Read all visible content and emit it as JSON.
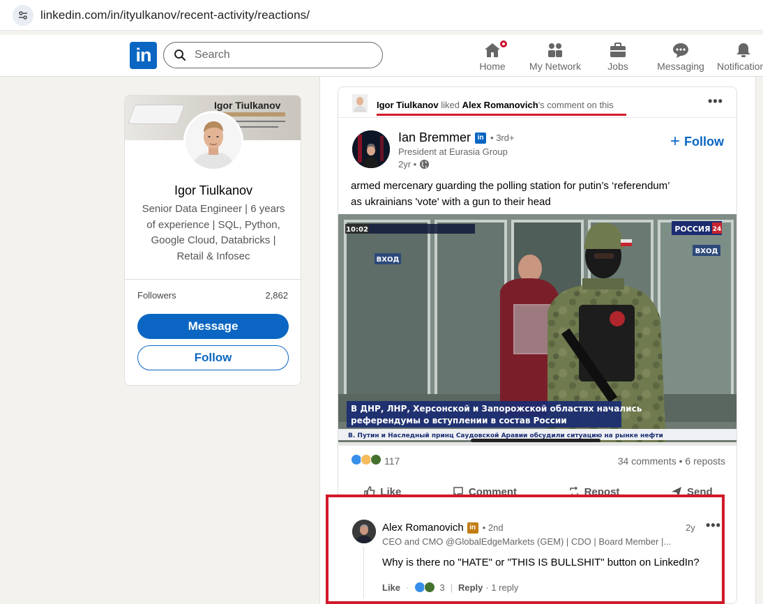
{
  "browser": {
    "url": "linkedin.com/in/ityulkanov/recent-activity/reactions/"
  },
  "nav": {
    "search_placeholder": "Search",
    "items": [
      {
        "label": "Home",
        "icon": "home-icon"
      },
      {
        "label": "My Network",
        "icon": "network-icon"
      },
      {
        "label": "Jobs",
        "icon": "briefcase-icon"
      },
      {
        "label": "Messaging",
        "icon": "chat-icon"
      },
      {
        "label": "Notifications",
        "icon": "bell-icon"
      }
    ]
  },
  "profile": {
    "banner_name": "Igor Tiulkanov",
    "name": "Igor Tiulkanov",
    "headline": "Senior Data Engineer | 6 years of experience | SQL, Python, Google Cloud, Databricks | Retail & Infosec",
    "followers_label": "Followers",
    "followers_count": "2,862",
    "message_label": "Message",
    "follow_label": "Follow"
  },
  "activity": {
    "actor": "Igor Tiulkanov",
    "verb": "liked",
    "target": "Alex Romanovich",
    "suffix": "'s comment on this"
  },
  "post": {
    "author": "Ian Bremmer",
    "degree": "• 3rd+",
    "author_title": "President at Eurasia Group",
    "time": "2yr •",
    "follow_label": "Follow",
    "text_line1": "armed mercenary guarding the polling station for putin’s ‘referendum’",
    "text_line2": "as ukrainians 'vote' with a gun to their head",
    "image": {
      "clock": "10:02",
      "channel": "РОССИЯ",
      "channel_num": "24",
      "door_sign": "ВХОД",
      "caption_line1": "В ДНР, ЛНР, Херсонской и Запорожской областях начались",
      "caption_line2": "референдумы о вступлении в состав России",
      "ticker": "В. Путин и Наследный принц Саудовской Аравии обсудили ситуацию на рынке нефти"
    },
    "reactions_count": "117",
    "comments_reposts": "34 comments • 6 reposts",
    "actions": {
      "like": "Like",
      "comment": "Comment",
      "repost": "Repost",
      "send": "Send"
    }
  },
  "comment": {
    "author": "Alex Romanovich",
    "degree": "• 2nd",
    "time": "2y",
    "title": "CEO and CMO @GlobalEdgeMarkets (GEM) | CDO | Board Member |...",
    "text": "Why is there no \"HATE\" or \"THIS IS BULLSHIT\" button on LinkedIn?",
    "like_label": "Like",
    "reaction_count": "3",
    "reply_label": "Reply",
    "replies": "· 1 reply"
  },
  "colors": {
    "linkedin_blue": "#0a66c2",
    "highlight_red": "#d11a2a",
    "premium_gold": "#c37d16"
  }
}
